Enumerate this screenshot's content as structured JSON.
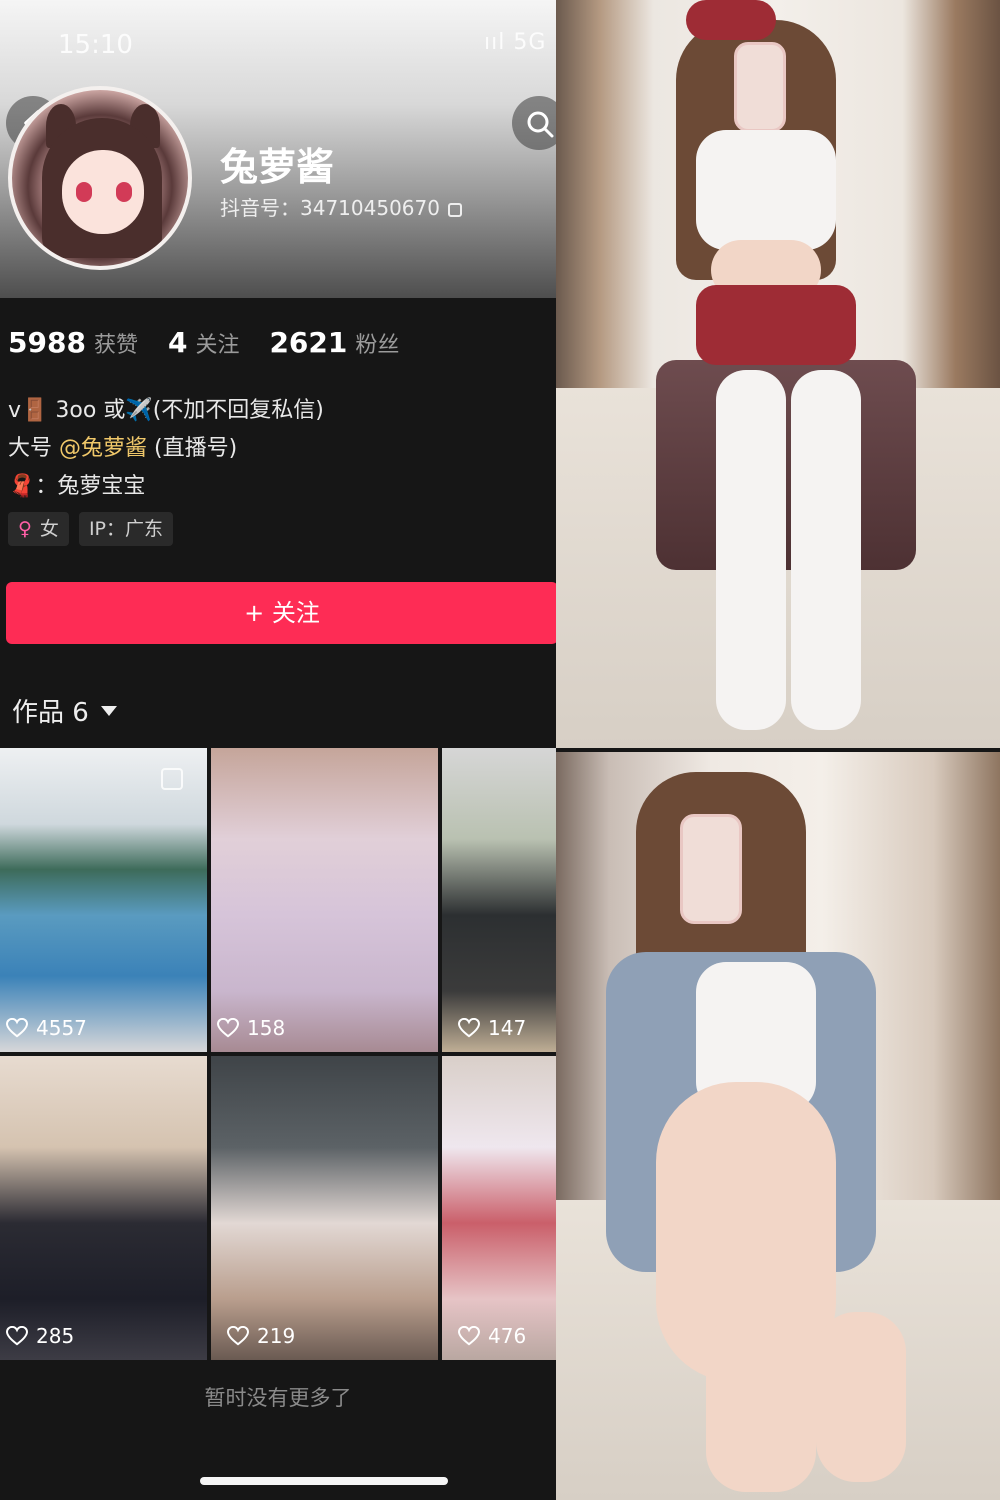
{
  "status_bar": {
    "time": "15:10",
    "signal": "ııl 5G"
  },
  "profile": {
    "username": "兔萝酱",
    "douyin_id": "抖音号：34710450670"
  },
  "stats": [
    {
      "value": "5988",
      "label": "获赞"
    },
    {
      "value": "4",
      "label": "关注"
    },
    {
      "value": "2621",
      "label": "粉丝"
    }
  ],
  "bio": {
    "line1": "v🚪 3oo 或✈️(不加不回复私信)",
    "line2_prefix": "大号",
    "line2_mention": "@兔萝酱",
    "line2_suffix": "(直播号)",
    "line3": "🧣：兔萝宝宝"
  },
  "tags": {
    "gender_icon": "♀",
    "gender": "女",
    "ip": "IP：广东"
  },
  "follow_button": "+ 关注",
  "works": {
    "label": "作品 6"
  },
  "videos": [
    {
      "likes": "4557"
    },
    {
      "likes": "158"
    },
    {
      "likes": "147"
    },
    {
      "likes": "285"
    },
    {
      "likes": "219"
    },
    {
      "likes": "476"
    }
  ],
  "no_more_text": "暂时没有更多了",
  "colors": {
    "accent": "#fe2c55",
    "mention": "#f0c86a",
    "background": "#161616"
  }
}
